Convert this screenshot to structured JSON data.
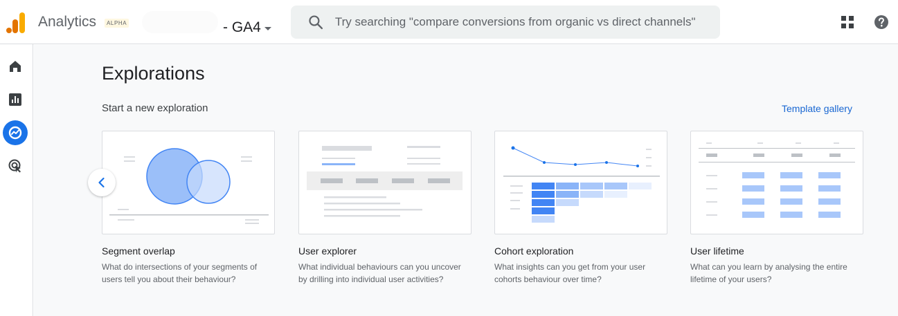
{
  "header": {
    "app_name": "Analytics",
    "badge": "ALPHA",
    "property_name": "- GA4",
    "search_placeholder": "Try searching \"compare conversions from organic vs direct channels\""
  },
  "icons": {
    "logo": "analytics-logo-icon",
    "search": "search-icon",
    "apps": "apps-grid-icon",
    "help": "help-icon",
    "nav": [
      "home-icon",
      "reports-icon",
      "explore-icon",
      "advertising-icon"
    ]
  },
  "main": {
    "title": "Explorations",
    "section_title": "Start a new exploration",
    "template_link": "Template gallery",
    "cards": [
      {
        "title": "Segment overlap",
        "description": "What do intersections of your segments of users tell you about their behaviour?"
      },
      {
        "title": "User explorer",
        "description": "What individual behaviours can you uncover by drilling into individual user activities?"
      },
      {
        "title": "Cohort exploration",
        "description": "What insights can you get from your user cohorts behaviour over time?"
      },
      {
        "title": "User lifetime",
        "description": "What can you learn by analysing the entire lifetime of your users?"
      }
    ]
  },
  "colors": {
    "accent": "#1a73e8",
    "link": "#1967d2",
    "logo_orange": "#f9ab00",
    "logo_dark_orange": "#e37400",
    "illustration_blue": "#8ab4f8",
    "illustration_dark_blue": "#4285f4"
  }
}
